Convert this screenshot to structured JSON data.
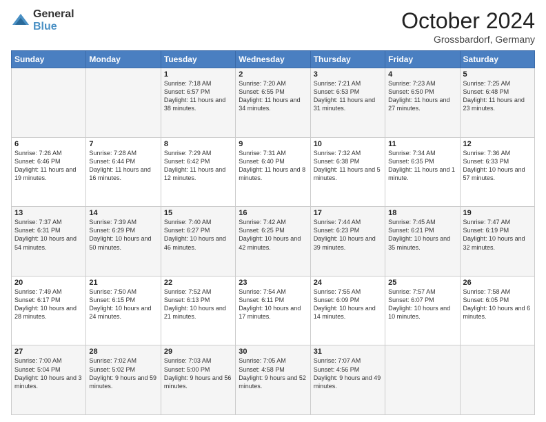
{
  "header": {
    "logo": {
      "general": "General",
      "blue": "Blue"
    },
    "month": "October 2024",
    "location": "Grossbardorf, Germany"
  },
  "days_of_week": [
    "Sunday",
    "Monday",
    "Tuesday",
    "Wednesday",
    "Thursday",
    "Friday",
    "Saturday"
  ],
  "weeks": [
    [
      {
        "day": "",
        "content": ""
      },
      {
        "day": "",
        "content": ""
      },
      {
        "day": "1",
        "sunrise": "Sunrise: 7:18 AM",
        "sunset": "Sunset: 6:57 PM",
        "daylight": "Daylight: 11 hours and 38 minutes."
      },
      {
        "day": "2",
        "sunrise": "Sunrise: 7:20 AM",
        "sunset": "Sunset: 6:55 PM",
        "daylight": "Daylight: 11 hours and 34 minutes."
      },
      {
        "day": "3",
        "sunrise": "Sunrise: 7:21 AM",
        "sunset": "Sunset: 6:53 PM",
        "daylight": "Daylight: 11 hours and 31 minutes."
      },
      {
        "day": "4",
        "sunrise": "Sunrise: 7:23 AM",
        "sunset": "Sunset: 6:50 PM",
        "daylight": "Daylight: 11 hours and 27 minutes."
      },
      {
        "day": "5",
        "sunrise": "Sunrise: 7:25 AM",
        "sunset": "Sunset: 6:48 PM",
        "daylight": "Daylight: 11 hours and 23 minutes."
      }
    ],
    [
      {
        "day": "6",
        "sunrise": "Sunrise: 7:26 AM",
        "sunset": "Sunset: 6:46 PM",
        "daylight": "Daylight: 11 hours and 19 minutes."
      },
      {
        "day": "7",
        "sunrise": "Sunrise: 7:28 AM",
        "sunset": "Sunset: 6:44 PM",
        "daylight": "Daylight: 11 hours and 16 minutes."
      },
      {
        "day": "8",
        "sunrise": "Sunrise: 7:29 AM",
        "sunset": "Sunset: 6:42 PM",
        "daylight": "Daylight: 11 hours and 12 minutes."
      },
      {
        "day": "9",
        "sunrise": "Sunrise: 7:31 AM",
        "sunset": "Sunset: 6:40 PM",
        "daylight": "Daylight: 11 hours and 8 minutes."
      },
      {
        "day": "10",
        "sunrise": "Sunrise: 7:32 AM",
        "sunset": "Sunset: 6:38 PM",
        "daylight": "Daylight: 11 hours and 5 minutes."
      },
      {
        "day": "11",
        "sunrise": "Sunrise: 7:34 AM",
        "sunset": "Sunset: 6:35 PM",
        "daylight": "Daylight: 11 hours and 1 minute."
      },
      {
        "day": "12",
        "sunrise": "Sunrise: 7:36 AM",
        "sunset": "Sunset: 6:33 PM",
        "daylight": "Daylight: 10 hours and 57 minutes."
      }
    ],
    [
      {
        "day": "13",
        "sunrise": "Sunrise: 7:37 AM",
        "sunset": "Sunset: 6:31 PM",
        "daylight": "Daylight: 10 hours and 54 minutes."
      },
      {
        "day": "14",
        "sunrise": "Sunrise: 7:39 AM",
        "sunset": "Sunset: 6:29 PM",
        "daylight": "Daylight: 10 hours and 50 minutes."
      },
      {
        "day": "15",
        "sunrise": "Sunrise: 7:40 AM",
        "sunset": "Sunset: 6:27 PM",
        "daylight": "Daylight: 10 hours and 46 minutes."
      },
      {
        "day": "16",
        "sunrise": "Sunrise: 7:42 AM",
        "sunset": "Sunset: 6:25 PM",
        "daylight": "Daylight: 10 hours and 42 minutes."
      },
      {
        "day": "17",
        "sunrise": "Sunrise: 7:44 AM",
        "sunset": "Sunset: 6:23 PM",
        "daylight": "Daylight: 10 hours and 39 minutes."
      },
      {
        "day": "18",
        "sunrise": "Sunrise: 7:45 AM",
        "sunset": "Sunset: 6:21 PM",
        "daylight": "Daylight: 10 hours and 35 minutes."
      },
      {
        "day": "19",
        "sunrise": "Sunrise: 7:47 AM",
        "sunset": "Sunset: 6:19 PM",
        "daylight": "Daylight: 10 hours and 32 minutes."
      }
    ],
    [
      {
        "day": "20",
        "sunrise": "Sunrise: 7:49 AM",
        "sunset": "Sunset: 6:17 PM",
        "daylight": "Daylight: 10 hours and 28 minutes."
      },
      {
        "day": "21",
        "sunrise": "Sunrise: 7:50 AM",
        "sunset": "Sunset: 6:15 PM",
        "daylight": "Daylight: 10 hours and 24 minutes."
      },
      {
        "day": "22",
        "sunrise": "Sunrise: 7:52 AM",
        "sunset": "Sunset: 6:13 PM",
        "daylight": "Daylight: 10 hours and 21 minutes."
      },
      {
        "day": "23",
        "sunrise": "Sunrise: 7:54 AM",
        "sunset": "Sunset: 6:11 PM",
        "daylight": "Daylight: 10 hours and 17 minutes."
      },
      {
        "day": "24",
        "sunrise": "Sunrise: 7:55 AM",
        "sunset": "Sunset: 6:09 PM",
        "daylight": "Daylight: 10 hours and 14 minutes."
      },
      {
        "day": "25",
        "sunrise": "Sunrise: 7:57 AM",
        "sunset": "Sunset: 6:07 PM",
        "daylight": "Daylight: 10 hours and 10 minutes."
      },
      {
        "day": "26",
        "sunrise": "Sunrise: 7:58 AM",
        "sunset": "Sunset: 6:05 PM",
        "daylight": "Daylight: 10 hours and 6 minutes."
      }
    ],
    [
      {
        "day": "27",
        "sunrise": "Sunrise: 7:00 AM",
        "sunset": "Sunset: 5:04 PM",
        "daylight": "Daylight: 10 hours and 3 minutes."
      },
      {
        "day": "28",
        "sunrise": "Sunrise: 7:02 AM",
        "sunset": "Sunset: 5:02 PM",
        "daylight": "Daylight: 9 hours and 59 minutes."
      },
      {
        "day": "29",
        "sunrise": "Sunrise: 7:03 AM",
        "sunset": "Sunset: 5:00 PM",
        "daylight": "Daylight: 9 hours and 56 minutes."
      },
      {
        "day": "30",
        "sunrise": "Sunrise: 7:05 AM",
        "sunset": "Sunset: 4:58 PM",
        "daylight": "Daylight: 9 hours and 52 minutes."
      },
      {
        "day": "31",
        "sunrise": "Sunrise: 7:07 AM",
        "sunset": "Sunset: 4:56 PM",
        "daylight": "Daylight: 9 hours and 49 minutes."
      },
      {
        "day": "",
        "content": ""
      },
      {
        "day": "",
        "content": ""
      }
    ]
  ]
}
